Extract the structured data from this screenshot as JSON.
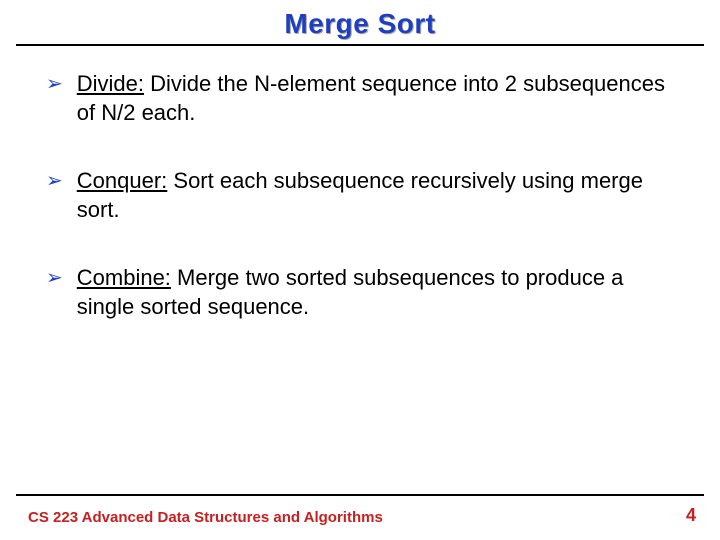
{
  "title": "Merge Sort",
  "bullets": [
    {
      "label": "Divide:",
      "rest": " Divide the N-element sequence into 2 subsequences of N/2 each."
    },
    {
      "label": "Conquer:",
      "rest": " Sort each subsequence recursively using merge sort."
    },
    {
      "label": "Combine:",
      "rest": " Merge two sorted subsequences to produce a single sorted sequence."
    }
  ],
  "footer": "CS 223 Advanced Data Structures and Algorithms",
  "page": "4",
  "bullet_glyph": "➢"
}
